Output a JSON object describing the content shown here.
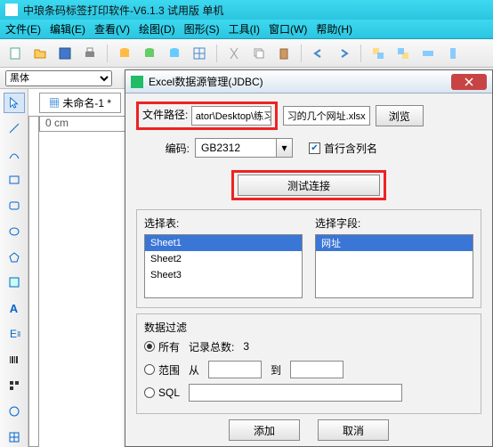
{
  "app": {
    "title": "中琅条码标签打印软件-V6.1.3 试用版 单机"
  },
  "menu": {
    "file": "文件(E)",
    "edit": "编辑(E)",
    "view": "查看(V)",
    "draw": "绘图(D)",
    "shape": "图形(S)",
    "tool": "工具(I)",
    "window": "窗口(W)",
    "help": "帮助(H)"
  },
  "fontbar": {
    "font": "黑体"
  },
  "doc": {
    "tab": "未命名-1 *",
    "ruler0": "0 cm"
  },
  "dialog": {
    "title": "Excel数据源管理(JDBC)",
    "path_label": "文件路径:",
    "path_value": "ator\\Desktop\\练习的几个网址.xlsx",
    "browse": "浏览",
    "encoding_label": "编码:",
    "encoding_value": "GB2312",
    "first_row_header": "首行含列名",
    "test": "测试连接",
    "select_table": "选择表:",
    "select_field": "选择字段:",
    "tables": [
      "Sheet1",
      "Sheet2",
      "Sheet3"
    ],
    "fields": [
      "网址"
    ],
    "filter": {
      "label": "数据过滤",
      "all": "所有",
      "total_label": "记录总数:",
      "total": "3",
      "range": "范围",
      "from": "从",
      "to": "到",
      "sql": "SQL"
    },
    "add": "添加",
    "cancel": "取消"
  }
}
